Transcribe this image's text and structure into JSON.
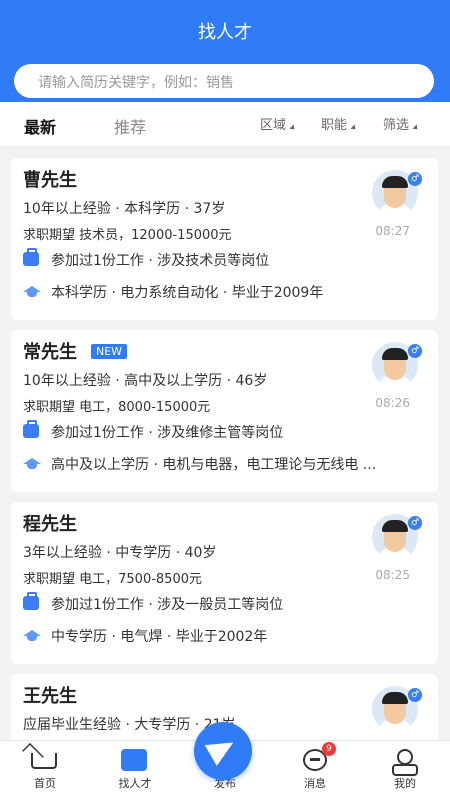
{
  "header": {
    "title": "找人才",
    "search_placeholder": "请输入简历关键字，例如：销售"
  },
  "tabs": {
    "latest": "最新",
    "recommend": "推荐"
  },
  "filters": [
    "区域",
    "职能",
    "筛选"
  ],
  "cards": [
    {
      "name": "曹先生",
      "new": "",
      "meta": "10年以上经验 · 本科学历 · 37岁",
      "expect": "求职期望 技术员，12000-15000元",
      "work": "参加过1份工作 · 涉及技术员等岗位",
      "edu": "本科学历 · 电力系统自动化 · 毕业于2009年",
      "time": "08:27",
      "sex": "♂"
    },
    {
      "name": "常先生",
      "new": "NEW",
      "meta": "10年以上经验 · 高中及以上学历 · 46岁",
      "expect": "求职期望 电工，8000-15000元",
      "work": "参加过1份工作 · 涉及维修主管等岗位",
      "edu": "高中及以上学历 · 电机与电器，电工理论与无线电 ...",
      "time": "08:26",
      "sex": "♂"
    },
    {
      "name": "程先生",
      "new": "",
      "meta": "3年以上经验 · 中专学历 · 40岁",
      "expect": "求职期望 电工，7500-8500元",
      "work": "参加过1份工作 · 涉及一般员工等岗位",
      "edu": "中专学历 · 电气焊 · 毕业于2002年",
      "time": "08:25",
      "sex": "♂"
    },
    {
      "name": "王先生",
      "new": "",
      "meta": "应届毕业生经验 · 大专学历 · 21岁",
      "expect": "",
      "work": "",
      "edu": "",
      "time": "",
      "sex": "♂"
    }
  ],
  "tabbar": {
    "home": "首页",
    "find": "找人才",
    "publish": "发布",
    "msg": "消息",
    "msg_badge": "9",
    "me": "我的"
  }
}
